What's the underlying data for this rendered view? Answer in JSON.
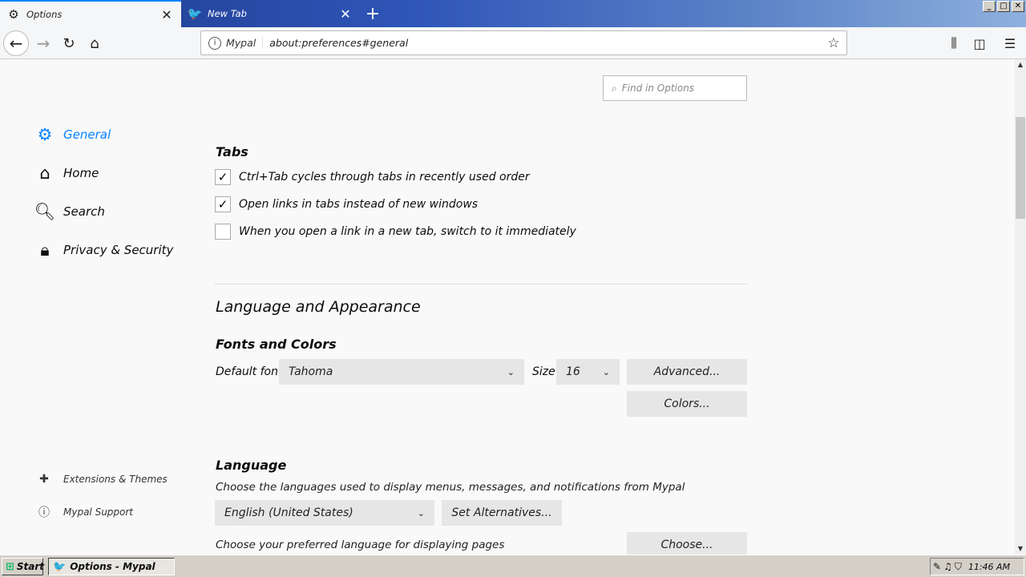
{
  "tabs": [
    {
      "label": "Options",
      "icon": "gear-icon",
      "active": true
    },
    {
      "label": "New Tab",
      "icon": "mypal-icon",
      "active": false
    }
  ],
  "window_buttons": [
    "_",
    "□",
    "✕"
  ],
  "urlbar": {
    "identity": "Mypal",
    "url": "about:preferences#general"
  },
  "search": {
    "placeholder": "Find in Options"
  },
  "categories": [
    {
      "label": "General",
      "icon": "gear-icon",
      "selected": true
    },
    {
      "label": "Home",
      "icon": "home-icon",
      "selected": false
    },
    {
      "label": "Search",
      "icon": "search-icon",
      "selected": false
    },
    {
      "label": "Privacy & Security",
      "icon": "lock-icon",
      "selected": false
    }
  ],
  "footer_links": [
    {
      "label": "Extensions & Themes",
      "icon": "puzzle-icon"
    },
    {
      "label": "Mypal Support",
      "icon": "help-icon"
    }
  ],
  "tabs_section": {
    "heading": "Tabs",
    "options": [
      {
        "label": "Ctrl+Tab cycles through tabs in recently used order",
        "checked": true
      },
      {
        "label": "Open links in tabs instead of new windows",
        "checked": true
      },
      {
        "label": "When you open a link in a new tab, switch to it immediately",
        "checked": false
      }
    ]
  },
  "language_appearance": {
    "title": "Language and Appearance",
    "fonts_heading": "Fonts and Colors",
    "default_font_label": "Default font",
    "default_font_value": "Tahoma",
    "size_label": "Size",
    "size_value": "16",
    "advanced_button": "Advanced...",
    "colors_button": "Colors..."
  },
  "language": {
    "heading": "Language",
    "description": "Choose the languages used to display menus, messages, and notifications from Mypal",
    "selected_language": "English (United States)",
    "set_alternatives_button": "Set Alternatives...",
    "pages_description": "Choose your preferred language for displaying pages",
    "choose_button": "Choose..."
  },
  "taskbar": {
    "start_label": "Start",
    "task_label": "Options - Mypal",
    "clock": "11:46 AM"
  }
}
